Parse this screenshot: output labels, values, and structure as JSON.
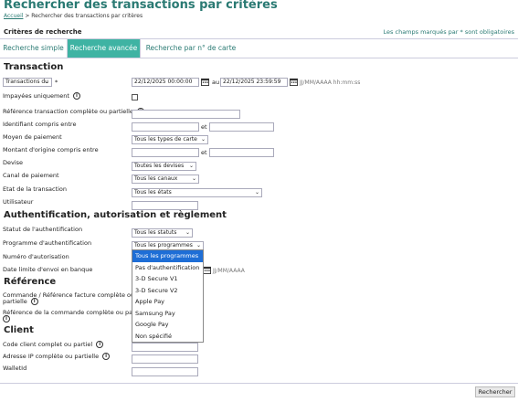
{
  "header": {
    "title": "Rechercher des transactions par critères",
    "breadcrumb_home": "Accueil",
    "breadcrumb_sep": " > ",
    "breadcrumb_current": "Rechercher des transactions par critères"
  },
  "criteria": {
    "title": "Critères de recherche",
    "required_note": "Les champs marqués par * sont obligatoires"
  },
  "tabs": [
    {
      "label": "Recherche simple",
      "active": false
    },
    {
      "label": "Recherche avancée",
      "active": true
    },
    {
      "label": "Recherche par n° de carte",
      "active": false
    }
  ],
  "transaction": {
    "section_title": "Transaction",
    "date_type": {
      "value": "Transactions du",
      "required_mark": "*"
    },
    "date_from": "22/12/2025 00:00:00",
    "date_to_label": "au",
    "date_to": "22/12/2025 23:59:59",
    "date_format": "JJ/MM/AAAA hh:mm:ss",
    "unpaid_label": "Impayées uniquement",
    "ref_label": "Référence transaction complète ou partielle",
    "identifier_label": "Identifiant compris entre",
    "and_label": "et",
    "payment_method_label": "Moyen de paiement",
    "payment_method_value": "Tous les types de carte",
    "amount_label": "Montant d'origine compris entre",
    "currency_label": "Devise",
    "currency_value": "Toutes les devises",
    "channel_label": "Canal de paiement",
    "channel_value": "Tous les canaux",
    "state_label": "Etat de la transaction",
    "state_value": "Tous les états",
    "user_label": "Utilisateur"
  },
  "auth": {
    "section_title": "Authentification, autorisation et règlement",
    "status_label": "Statut de l'authentification",
    "status_value": "Tous les statuts",
    "program_label": "Programme d'authentification",
    "program_value": "Tous les programmes",
    "auth_number_label": "Numéro d'autorisation",
    "bank_date_label": "Date limite d'envoi en banque",
    "bank_date_format": "JJ/MM/AAAA"
  },
  "program_options": [
    "Tous les programmes",
    "Pas d'authentification",
    "3-D Secure V1",
    "3-D Secure V2",
    "Apple Pay",
    "Samsung Pay",
    "Google Pay",
    "Non spécifié"
  ],
  "reference": {
    "section_title": "Référence",
    "order_label_1": "Commande / Référence facture complète ou",
    "order_label_2": "partielle",
    "full_order_label": "Référence de la commande complète ou partielle"
  },
  "client": {
    "section_title": "Client",
    "code_label": "Code client complet ou partiel",
    "ip_label": "Adresse IP complète ou partielle",
    "wallet_label": "WalletId"
  },
  "actions": {
    "search_label": "Rechercher"
  },
  "colors": {
    "accent": "#2a7a73",
    "tab_active": "#3fb3a3",
    "dropdown_selected": "#1e6ed6"
  }
}
